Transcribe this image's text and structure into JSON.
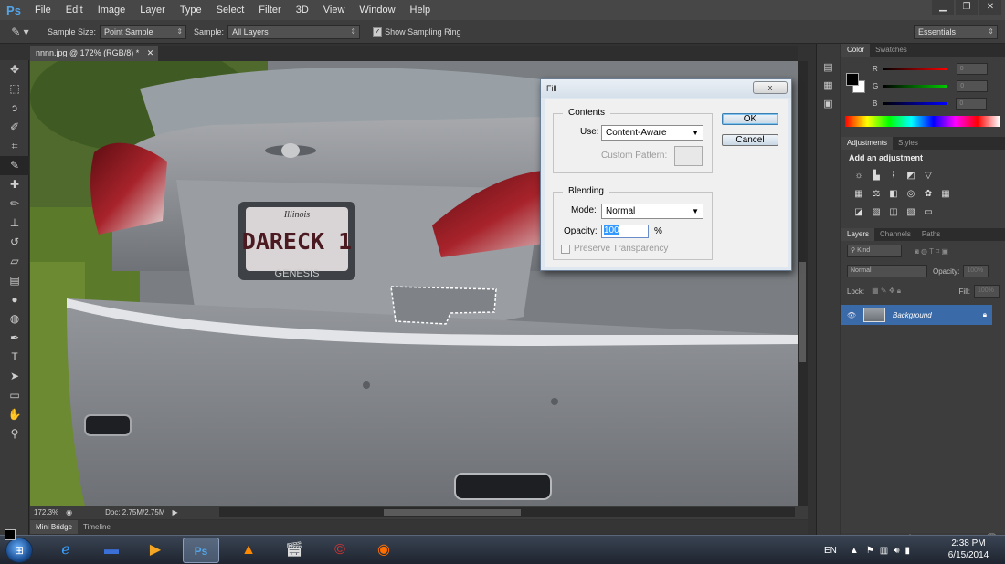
{
  "app": {
    "logo": "Ps"
  },
  "menu": [
    "File",
    "Edit",
    "Image",
    "Layer",
    "Type",
    "Select",
    "Filter",
    "3D",
    "View",
    "Window",
    "Help"
  ],
  "options_bar": {
    "sample_size_label": "Sample Size:",
    "sample_size_value": "Point Sample",
    "sample_label": "Sample:",
    "sample_value": "All Layers",
    "show_ring_label": "Show Sampling Ring",
    "workspace": "Essentials"
  },
  "document": {
    "tab_title": "nnnn.jpg @ 172% (RGB/8) *",
    "zoom": "172.3%",
    "doc_size": "Doc: 2.75M/2.75M",
    "plate_top": "Illinois",
    "plate_text": "DARECK 1",
    "plate_bottom": "GENESIS"
  },
  "bottom_tabs": [
    "Mini Bridge",
    "Timeline"
  ],
  "color_panel": {
    "tabs": [
      "Color",
      "Swatches"
    ],
    "channels": [
      {
        "label": "R",
        "color": "#ff0000"
      },
      {
        "label": "G",
        "color": "#00c000"
      },
      {
        "label": "B",
        "color": "#0000ff"
      }
    ],
    "channel_value": "0"
  },
  "adjustments_panel": {
    "tabs": [
      "Adjustments",
      "Styles"
    ],
    "title": "Add an adjustment"
  },
  "layers_panel": {
    "tabs": [
      "Layers",
      "Channels",
      "Paths"
    ],
    "filter": "Kind",
    "blend_mode": "Normal",
    "opacity_label": "Opacity:",
    "opacity_value": "100%",
    "lock_label": "Lock:",
    "fill_label": "Fill:",
    "fill_value": "100%",
    "layer_name": "Background"
  },
  "fill_dialog": {
    "title": "Fill",
    "close": "x",
    "contents_title": "Contents",
    "use_label": "Use:",
    "use_value": "Content-Aware",
    "custom_pattern_label": "Custom Pattern:",
    "blending_title": "Blending",
    "mode_label": "Mode:",
    "mode_value": "Normal",
    "opacity_label": "Opacity:",
    "opacity_value": "100",
    "opacity_unit": "%",
    "preserve_label": "Preserve Transparency",
    "ok": "OK",
    "cancel": "Cancel"
  },
  "taskbar": {
    "language": "EN",
    "time": "2:38 PM",
    "date": "6/15/2014"
  }
}
